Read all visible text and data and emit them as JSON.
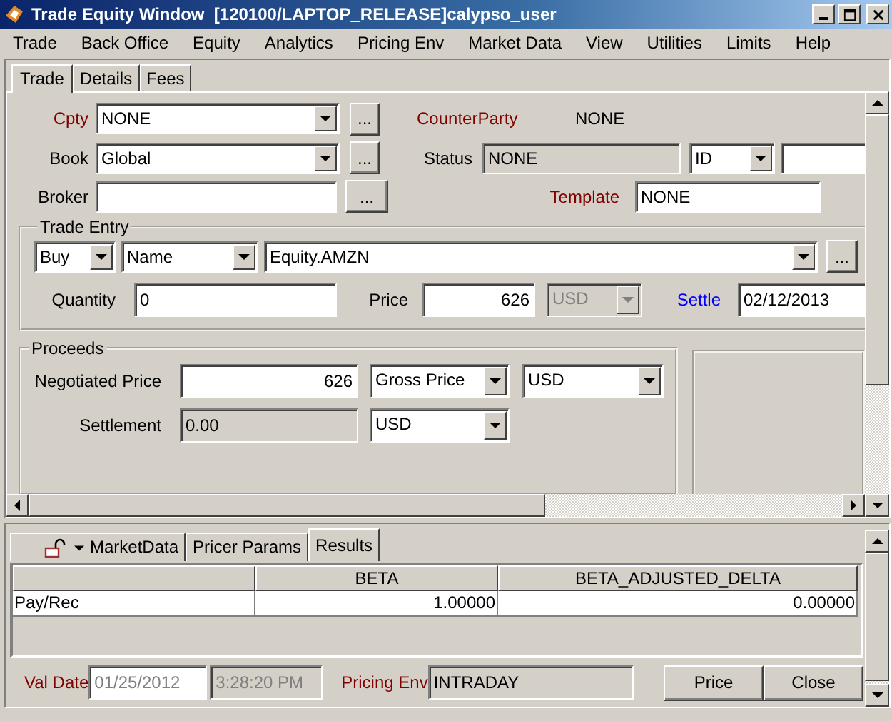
{
  "window": {
    "title": "Trade Equity Window  [120100/LAPTOP_RELEASE]calypso_user"
  },
  "menu": [
    "Trade",
    "Back Office",
    "Equity",
    "Analytics",
    "Pricing Env",
    "Market Data",
    "View",
    "Utilities",
    "Limits",
    "Help"
  ],
  "tabs": [
    {
      "label": "Trade",
      "selected": true
    },
    {
      "label": "Details",
      "selected": false
    },
    {
      "label": "Fees",
      "selected": false
    }
  ],
  "header": {
    "cpty": {
      "label": "Cpty",
      "kind": "required",
      "value": "NONE",
      "button": "..."
    },
    "counterparty": {
      "label": "CounterParty",
      "kind": "required",
      "value": "NONE"
    },
    "book": {
      "label": "Book",
      "value": "Global",
      "button": "..."
    },
    "status": {
      "label": "Status",
      "value": "NONE",
      "readonly": true
    },
    "id_type": "ID",
    "broker": {
      "label": "Broker",
      "button": "..."
    },
    "template": {
      "label": "Template",
      "kind": "required",
      "value": "NONE"
    }
  },
  "trade_entry": {
    "title": "Trade Entry",
    "direction": "Buy",
    "lookup": "Name",
    "product": "Equity.AMZN",
    "button": "...",
    "quantity": {
      "label": "Quantity",
      "value": "0"
    },
    "price": {
      "label": "Price",
      "value": "626",
      "currency": "USD",
      "currency_disabled": true
    },
    "settle": {
      "label": "Settle",
      "kind": "link",
      "value": "02/12/2013"
    }
  },
  "proceeds": {
    "title": "Proceeds",
    "negotiated_price": {
      "label": "Negotiated Price",
      "value": "626",
      "price_type": "Gross Price",
      "currency": "USD"
    },
    "settlement": {
      "label": "Settlement",
      "value": "0.00",
      "readonly": true,
      "currency": "USD"
    }
  },
  "bottom_tabs": [
    {
      "label": "MarketData",
      "kind": "menu",
      "selected": false
    },
    {
      "label": "Pricer Params",
      "kind": "plain",
      "selected": false
    },
    {
      "label": "Results",
      "kind": "plain",
      "selected": true
    }
  ],
  "results": {
    "columns": [
      {
        "label": "BETA"
      },
      {
        "label": "BETA_ADJUSTED_DELTA"
      }
    ],
    "rows": [
      {
        "name": "Pay/Rec",
        "values": [
          "1.00000",
          "0.00000"
        ]
      }
    ]
  },
  "footer": {
    "val_date": {
      "label": "Val Date",
      "kind": "required",
      "date": "01/25/2012",
      "time": "3:28:20 PM",
      "disabled": true
    },
    "pricing_env": {
      "label": "Pricing Env",
      "kind": "required",
      "value": "INTRADAY",
      "readonly": true
    },
    "buttons": [
      "Price",
      "Close"
    ]
  }
}
